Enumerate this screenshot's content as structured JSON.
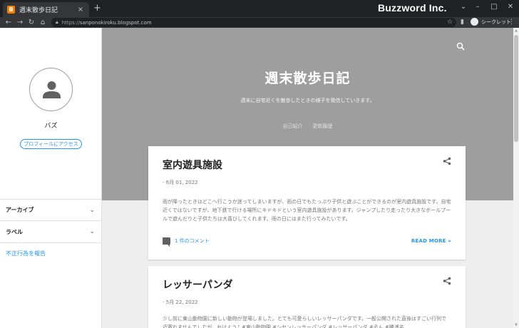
{
  "browser": {
    "tab_title": "週末散歩日記",
    "favicon_letter": "B",
    "tab_close": "×",
    "new_tab": "+",
    "url_scheme": "https://",
    "url_host": "sanponokiroku.blogspot.com",
    "incognito_label": "シークレット",
    "brand": "Buzzword Inc."
  },
  "sidebar": {
    "profile_name": "バズ",
    "profile_button": "プロフィールにアクセス",
    "sections": [
      {
        "label": "アーカイブ"
      },
      {
        "label": "ラベル"
      }
    ],
    "report_link": "不正行為を報告"
  },
  "hero": {
    "title": "週末散歩日記",
    "description": "週末に自宅近くを散歩したときの様子を発信していきます。",
    "nav": [
      "自己紹介",
      "更新履歴"
    ]
  },
  "posts": [
    {
      "title": "室内遊具施設",
      "date": "- 6月 01, 2022",
      "text": "雨が降ったときはどこへ行こうか迷ってしまいますが、雨の日でもたっぷり子供と遊ぶことができるのが室内遊具施設です。自宅近くではないですが、地下鉄で行ける場所にキドキドという室内遊具施設があります。ジャンプしたり走ったり大きなボールプールで遊んだりと子供たちは大喜びしてくれます。雨の日にはまた行ってみたいです。",
      "comments": "1 件のコメント",
      "read_more": "READ MORE »"
    },
    {
      "title": "レッサーパンダ",
      "date": "- 5月 22, 2022",
      "text": "少し前に東山動物園に新しい動物が登場しました。とても可愛らしいレッサーパンダです。一般公開された直後はすごい行列で近寄れませんでしたが、おはよう♪ #東山動物園 #シセンレッサーパンダ #レッサーパンダ #ぞん #勝浦名"
    }
  ],
  "colors": {
    "accent": "#2196f3",
    "hero_bg": "#9e9e9e",
    "chrome_dark": "#202124"
  }
}
